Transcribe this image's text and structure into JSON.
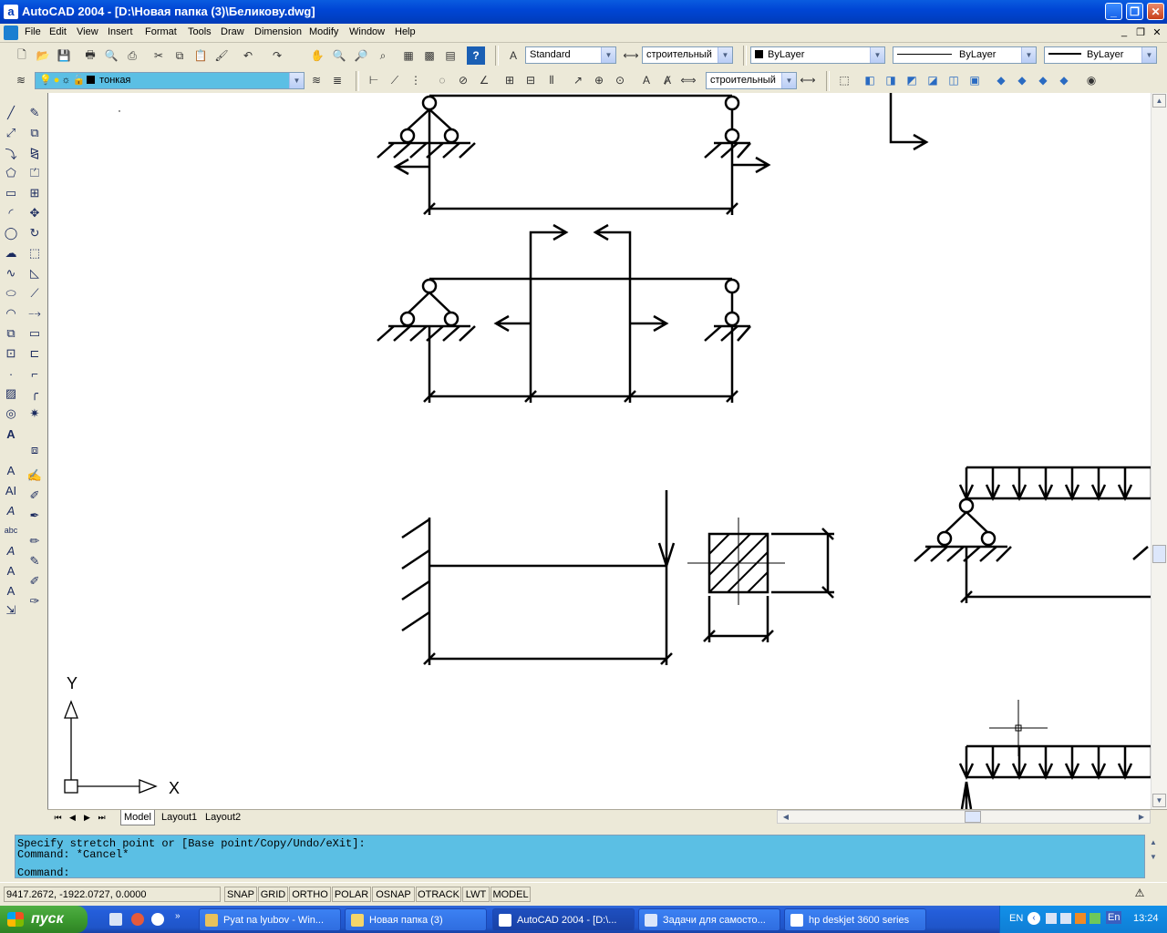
{
  "window": {
    "title": "AutoCAD 2004 - [D:\\Новая папка (3)\\Беликову.dwg]",
    "app_icon_label": "a",
    "controls": {
      "minimize": "_",
      "maximize": "❐",
      "close": "✕"
    }
  },
  "menu": {
    "items": [
      "File",
      "Edit",
      "View",
      "Insert",
      "Format",
      "Tools",
      "Draw",
      "Dimension",
      "Modify",
      "Window",
      "Help"
    ],
    "mdi_controls": {
      "minimize": "_",
      "restore": "❐",
      "close": "✕"
    }
  },
  "toolbar1": {
    "text_style": "Standard",
    "dim_style": "строительный",
    "color": "ByLayer",
    "linetype": "ByLayer",
    "lineweight": "ByLayer"
  },
  "toolbar2": {
    "layer": "тонкая",
    "dim_style": "строительный"
  },
  "tabs": {
    "items": [
      "Model",
      "Layout1",
      "Layout2"
    ],
    "active": "Model"
  },
  "drawing": {
    "ucs_x_label": "X",
    "ucs_y_label": "Y"
  },
  "command": {
    "line1": "Specify stretch point or [Base point/Copy/Undo/eXit]:",
    "line2": "Command: *Cancel*",
    "prompt": "Command:"
  },
  "status": {
    "coordinates": "9417.2672, -1922.0727, 0.0000",
    "buttons": [
      "SNAP",
      "GRID",
      "ORTHO",
      "POLAR",
      "OSNAP",
      "OTRACK",
      "LWT",
      "MODEL"
    ]
  },
  "taskbar": {
    "start_label": "пуск",
    "items": [
      {
        "label": "Pyat na lyubov - Win...",
        "active": false
      },
      {
        "label": "Новая папка (3)",
        "active": false
      },
      {
        "label": "AutoCAD 2004 - [D:\\...",
        "active": true
      },
      {
        "label": "Задачи для самосто...",
        "active": false
      },
      {
        "label": "hp deskjet 3600 series",
        "active": false
      }
    ],
    "tray": {
      "lang": "EN",
      "lang2": "En",
      "time": "13:24"
    }
  }
}
